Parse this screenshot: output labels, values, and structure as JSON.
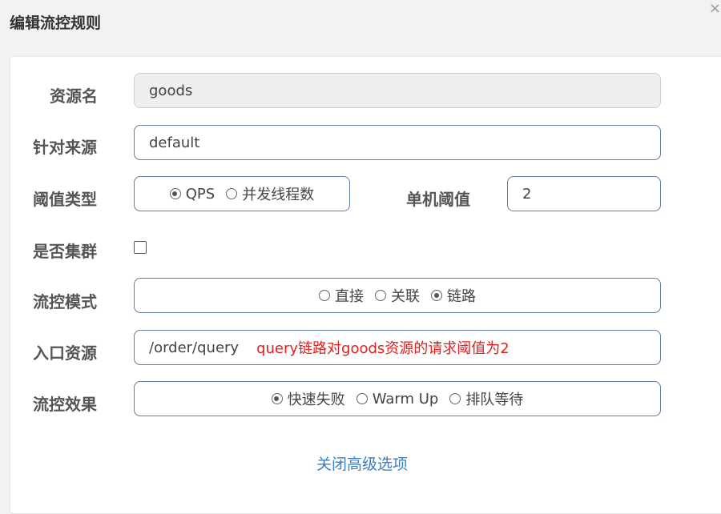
{
  "dialog": {
    "title": "编辑流控规则",
    "close_icon": "close-icon"
  },
  "form": {
    "resource": {
      "label": "资源名",
      "value": "goods"
    },
    "limit_app": {
      "label": "针对来源",
      "value": "default"
    },
    "grade": {
      "label": "阈值类型",
      "options": [
        {
          "label": "QPS",
          "checked": true
        },
        {
          "label": "并发线程数",
          "checked": false
        }
      ]
    },
    "count": {
      "label": "单机阈值",
      "value": "2"
    },
    "cluster": {
      "label": "是否集群",
      "checked": false
    },
    "strategy": {
      "label": "流控模式",
      "options": [
        {
          "label": "直接",
          "checked": false
        },
        {
          "label": "关联",
          "checked": false
        },
        {
          "label": "链路",
          "checked": true
        }
      ]
    },
    "ref_resource": {
      "label": "入口资源",
      "value": "/order/query",
      "note": "query链路对goods资源的请求阈值为2"
    },
    "control_behavior": {
      "label": "流控效果",
      "options": [
        {
          "label": "快速失败",
          "checked": true
        },
        {
          "label": "Warm Up",
          "checked": false
        },
        {
          "label": "排队等待",
          "checked": false
        }
      ]
    }
  },
  "advanced_toggle": {
    "label": "关闭高级选项"
  },
  "colors": {
    "accent_link": "#3a7fc0",
    "note_red": "#e02020",
    "input_border": "#5e7fa8"
  }
}
